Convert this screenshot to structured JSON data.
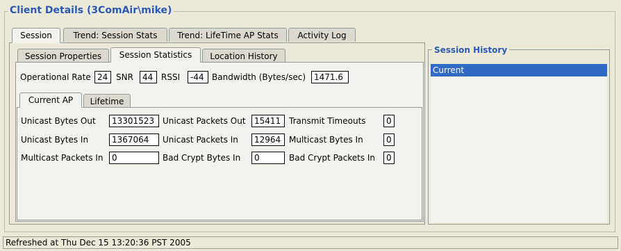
{
  "title": "Client Details (3ComAir\\mike)",
  "top_tabs": [
    "Session",
    "Trend: Session Stats",
    "Trend: LifeTime AP Stats",
    "Activity Log"
  ],
  "sub_tabs": [
    "Session Properties",
    "Session Statistics",
    "Location History"
  ],
  "operational": {
    "rate_label": "Operational Rate",
    "rate_value": "24",
    "snr_label": "SNR",
    "snr_value": "44",
    "rssi_label": "RSSI",
    "rssi_value": "-44",
    "bandwidth_label": "Bandwidth (Bytes/sec)",
    "bandwidth_value": "1471.6"
  },
  "ap_tabs": [
    "Current AP",
    "Lifetime"
  ],
  "stats": {
    "unicast_bytes_out_label": "Unicast Bytes Out",
    "unicast_bytes_out": "13301523",
    "unicast_packets_out_label": "Unicast Packets Out",
    "unicast_packets_out": "15411",
    "transmit_timeouts_label": "Transmit Timeouts",
    "transmit_timeouts": "0",
    "unicast_bytes_in_label": "Unicast Bytes In",
    "unicast_bytes_in": "1367064",
    "unicast_packets_in_label": "Unicast Packets In",
    "unicast_packets_in": "12964",
    "multicast_bytes_in_label": "Multicast Bytes In",
    "multicast_bytes_in": "0",
    "multicast_packets_in_label": "Multicast Packets In",
    "multicast_packets_in": "0",
    "bad_crypt_bytes_in_label": "Bad Crypt Bytes In",
    "bad_crypt_bytes_in": "0",
    "bad_crypt_packets_in_label": "Bad Crypt Packets In",
    "bad_crypt_packets_in": "0"
  },
  "session_history": {
    "title": "Session History",
    "items": [
      "Current"
    ]
  },
  "status": "Refreshed at Thu Dec 15 13:20:36 PST 2005",
  "colors": {
    "accent": "#2a5ab5",
    "selection": "#316ac5",
    "background": "#ece9d8"
  }
}
